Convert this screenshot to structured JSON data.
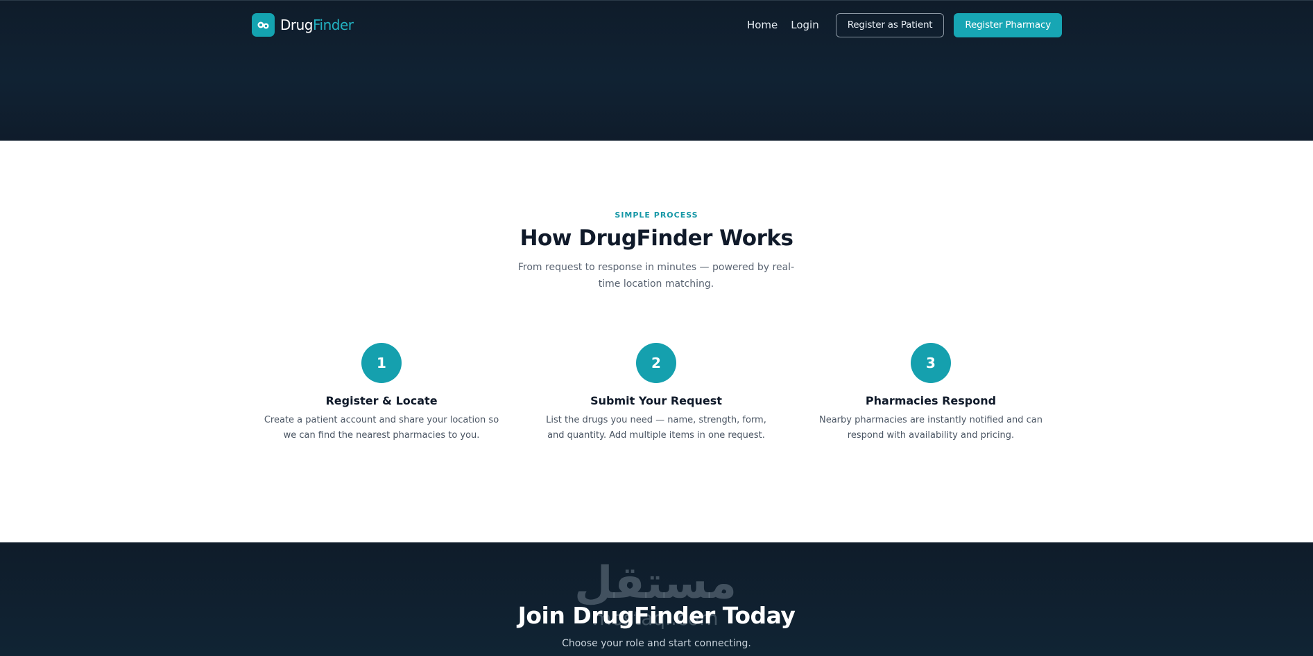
{
  "header": {
    "brand_part1": "Drug",
    "brand_part2": "Finder",
    "nav_home": "Home",
    "nav_login": "Login",
    "register_patient_label": "Register as Patient",
    "register_pharmacy_label": "Register Pharmacy"
  },
  "how_it_works": {
    "eyebrow": "SIMPLE PROCESS",
    "title": "How DrugFinder Works",
    "subtitle": "From request to response in minutes — powered by real-time location matching.",
    "steps": [
      {
        "number": "1",
        "title": "Register & Locate",
        "description": "Create a patient account and share your location so we can find the nearest pharmacies to you."
      },
      {
        "number": "2",
        "title": "Submit Your Request",
        "description": "List the drugs you need — name, strength, form, and quantity. Add multiple items in one request."
      },
      {
        "number": "3",
        "title": "Pharmacies Respond",
        "description": "Nearby pharmacies are instantly notified and can respond with availability and pricing."
      }
    ]
  },
  "cta": {
    "title": "Join DrugFinder Today",
    "subtitle": "Choose your role and start connecting."
  },
  "watermark": {
    "arabic": "مستقل",
    "latin": "mostaqi.com"
  },
  "colors": {
    "accent": "#17a6b4",
    "dark_band": "#0f1c2a",
    "heading": "#101a2a"
  },
  "icons": {
    "brand": "pill-logo-icon"
  }
}
